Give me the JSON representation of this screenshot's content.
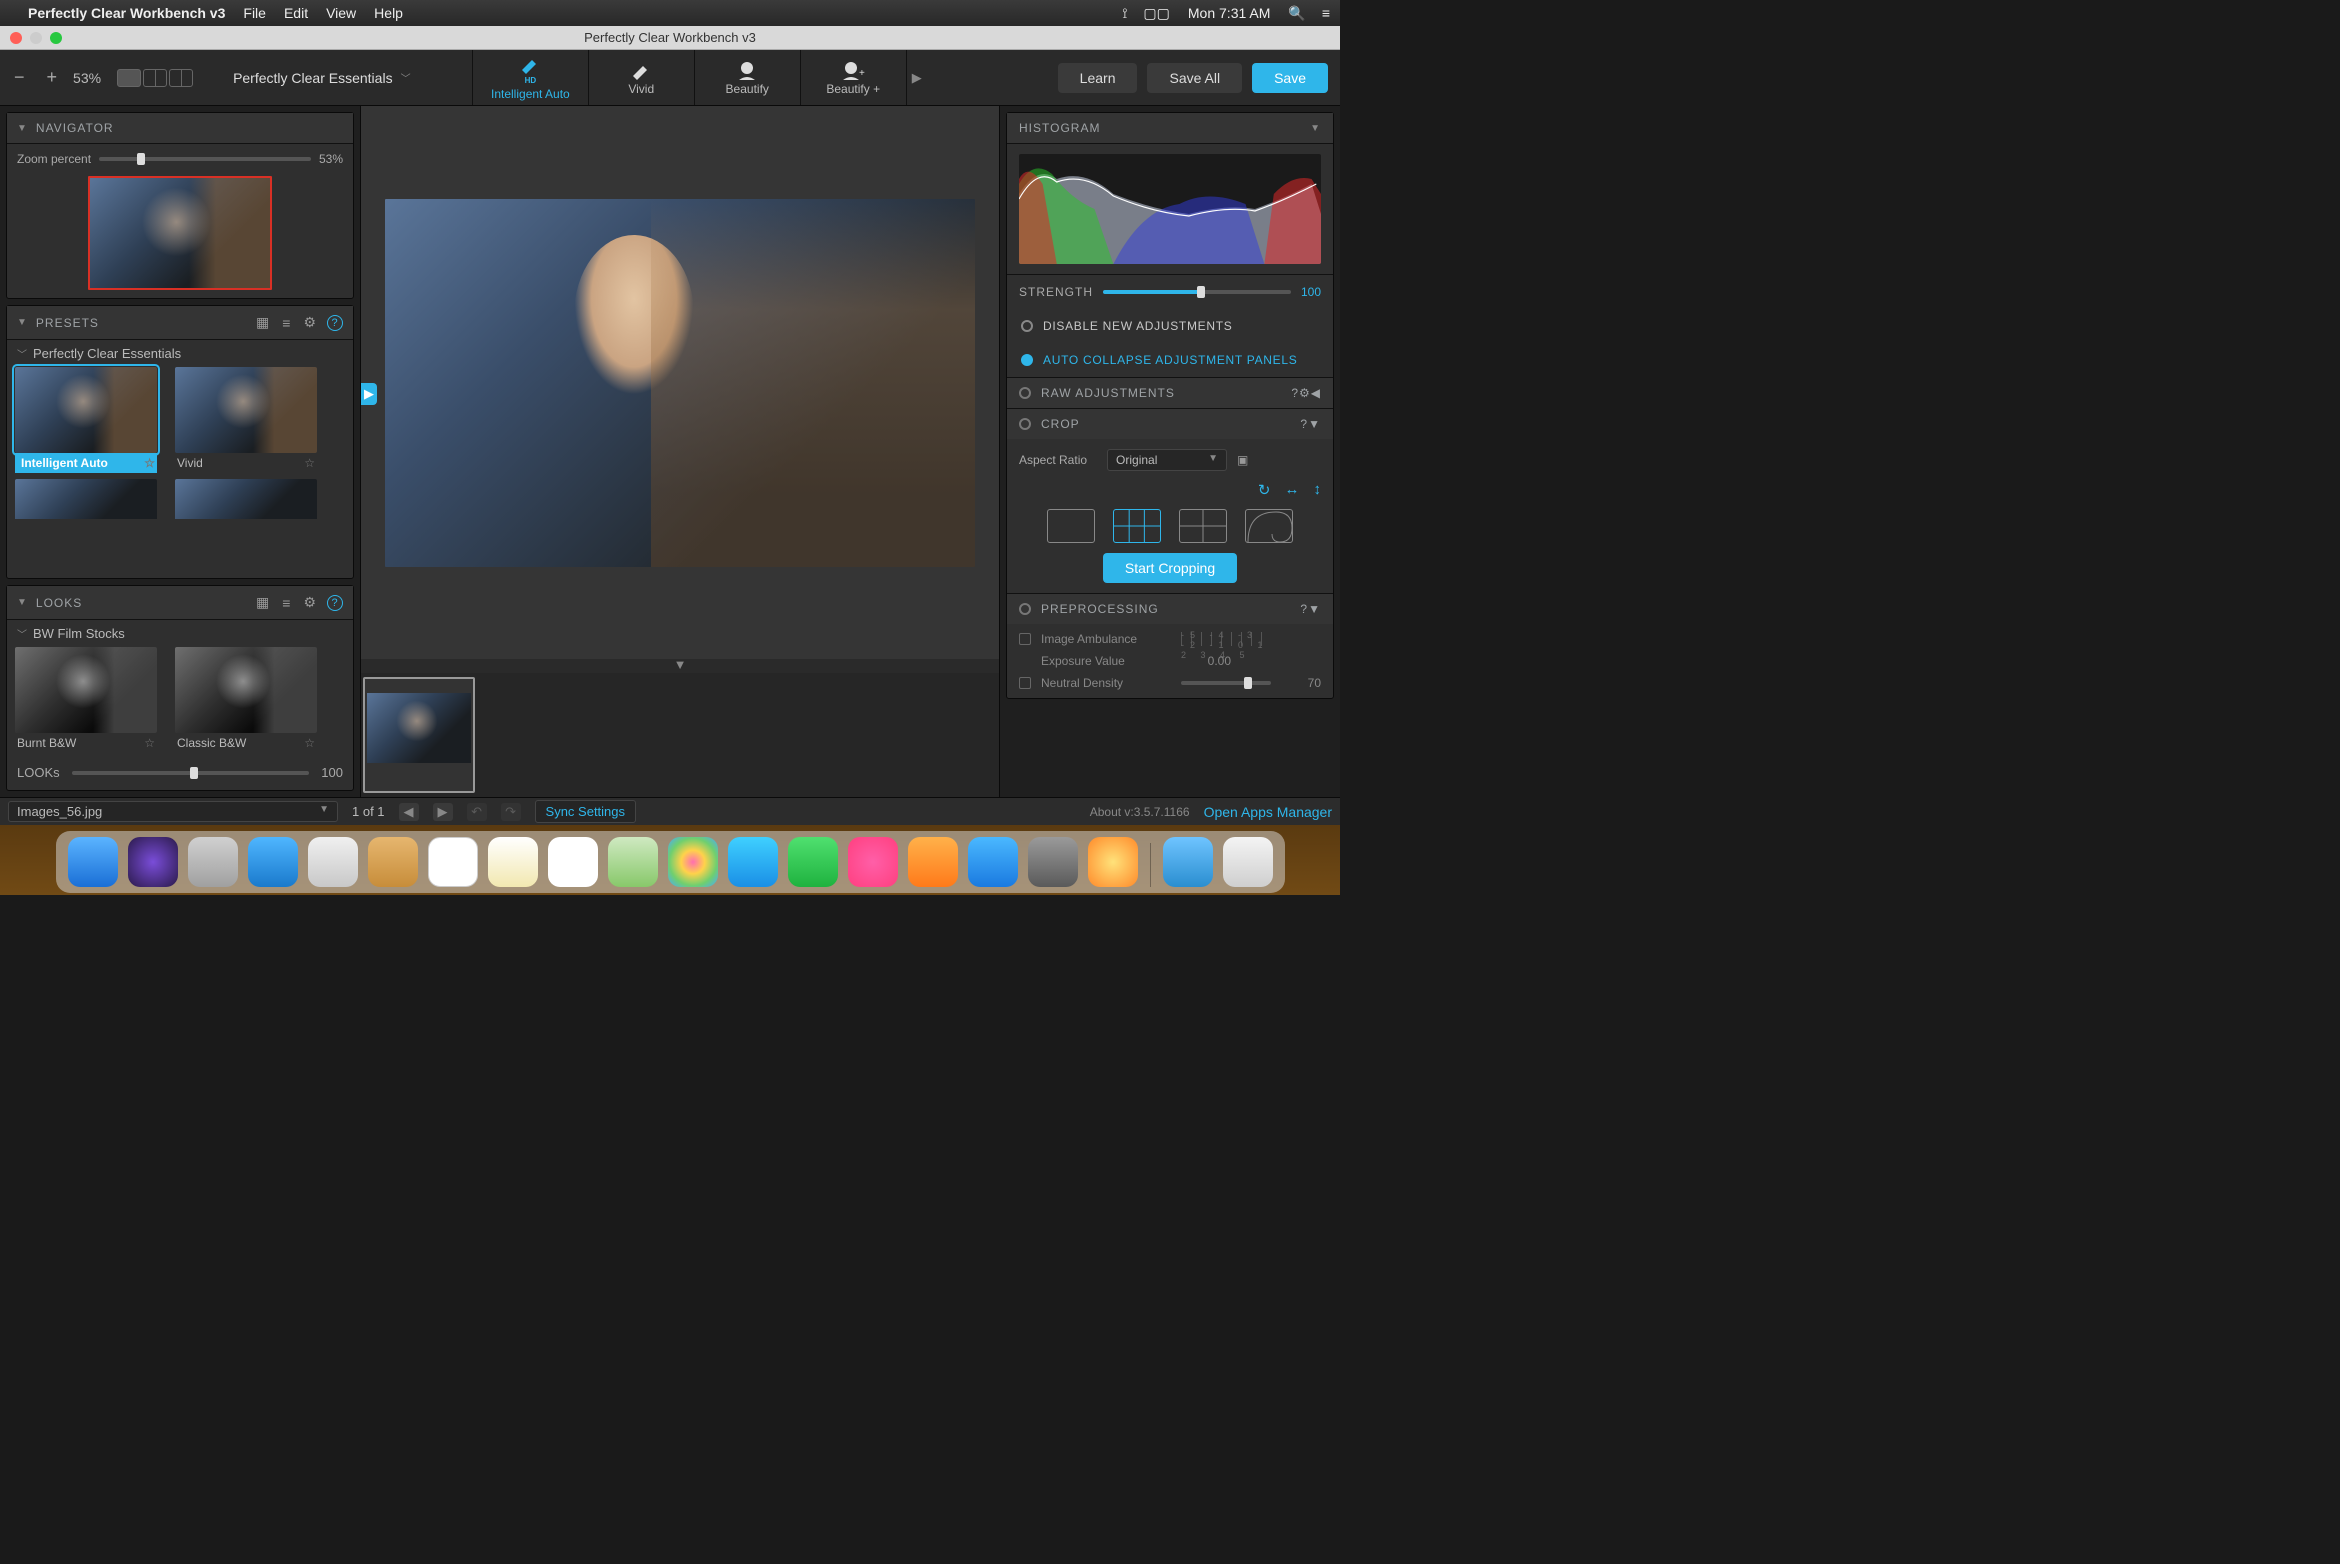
{
  "menubar": {
    "app_title": "Perfectly Clear Workbench v3",
    "items": [
      "File",
      "Edit",
      "View",
      "Help"
    ],
    "clock": "Mon 7:31 AM"
  },
  "window": {
    "title": "Perfectly Clear Workbench v3"
  },
  "toolbar": {
    "zoom_pct": "53%",
    "preset_selected": "Perfectly Clear Essentials",
    "tabs": [
      {
        "label": "Intelligent Auto",
        "hd": "HD",
        "active": true
      },
      {
        "label": "Vivid",
        "active": false
      },
      {
        "label": "Beautify",
        "active": false
      },
      {
        "label": "Beautify +",
        "active": false
      }
    ],
    "learn": "Learn",
    "save_all": "Save All",
    "save": "Save"
  },
  "navigator": {
    "header": "NAVIGATOR",
    "zoom_label": "Zoom percent",
    "zoom_value": "53%"
  },
  "presets": {
    "header": "PRESETS",
    "group": "Perfectly Clear Essentials",
    "items": [
      {
        "label": "Intelligent Auto",
        "selected": true
      },
      {
        "label": "Vivid",
        "selected": false
      }
    ]
  },
  "looks": {
    "header": "LOOKS",
    "group": "BW Film Stocks",
    "items": [
      {
        "label": "Burnt B&W"
      },
      {
        "label": "Classic B&W"
      }
    ],
    "slider_label": "LOOKs",
    "slider_value": "100"
  },
  "right": {
    "histogram": "HISTOGRAM",
    "strength_label": "STRENGTH",
    "strength_value": "100",
    "disable_new": "DISABLE NEW ADJUSTMENTS",
    "auto_collapse": "AUTO COLLAPSE ADJUSTMENT PANELS",
    "raw": "RAW ADJUSTMENTS",
    "crop": {
      "header": "CROP",
      "aspect_label": "Aspect Ratio",
      "aspect_value": "Original",
      "start": "Start Cropping"
    },
    "prep": {
      "header": "PREPROCESSING",
      "rows": [
        {
          "label": "Image Ambulance",
          "value": ""
        },
        {
          "label": "Exposure Value",
          "value": "0.00"
        },
        {
          "label": "Neutral Density",
          "value": "70"
        }
      ],
      "tick_labels": "-5 -4 -3 -2 -1 0 1 2 3 4 5"
    }
  },
  "status": {
    "filename": "Images_56.jpg",
    "page": "1 of 1",
    "sync": "Sync Settings",
    "about": "About v:3.5.7.1166",
    "apps_mgr": "Open Apps Manager"
  },
  "dock": [
    "finder",
    "siri",
    "launchpad",
    "safari",
    "mail",
    "contacts",
    "calendar",
    "notes",
    "reminders",
    "maps",
    "photos",
    "messages",
    "facetime",
    "itunes",
    "ibooks",
    "appstore",
    "settings",
    "pcw",
    "downloads",
    "trash"
  ]
}
